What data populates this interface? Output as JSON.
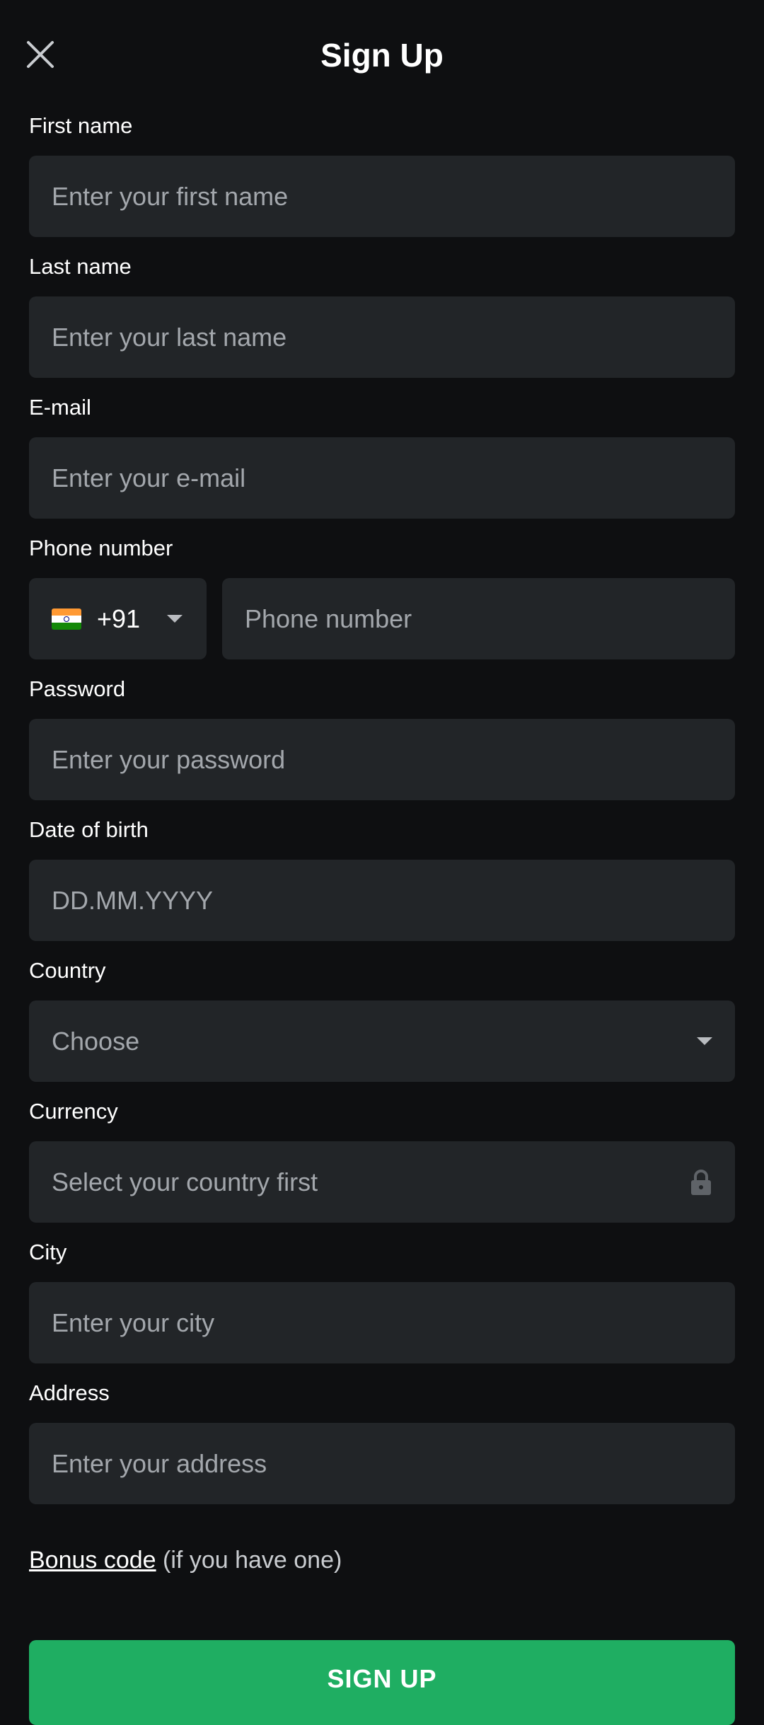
{
  "header": {
    "title": "Sign Up",
    "close_icon": "close-icon"
  },
  "form": {
    "first_name": {
      "label": "First name",
      "placeholder": "Enter your first name"
    },
    "last_name": {
      "label": "Last name",
      "placeholder": "Enter your last name"
    },
    "email": {
      "label": "E-mail",
      "placeholder": "Enter your e-mail"
    },
    "phone": {
      "label": "Phone number",
      "country_flag": "india-flag-icon",
      "code": "+91",
      "placeholder": "Phone number"
    },
    "password": {
      "label": "Password",
      "placeholder": "Enter your password"
    },
    "dob": {
      "label": "Date of birth",
      "placeholder": "DD.MM.YYYY"
    },
    "country": {
      "label": "Country",
      "value": "Choose"
    },
    "currency": {
      "label": "Currency",
      "value": "Select your country first",
      "icon": "lock-icon"
    },
    "city": {
      "label": "City",
      "placeholder": "Enter your city"
    },
    "address": {
      "label": "Address",
      "placeholder": "Enter your address"
    }
  },
  "bonus": {
    "link_text": "Bonus code",
    "suffix": "(if you have one)"
  },
  "signup_button": "SIGN UP",
  "colors": {
    "background": "#0e0f11",
    "field_bg": "#222528",
    "accent_green": "#1fae62"
  }
}
